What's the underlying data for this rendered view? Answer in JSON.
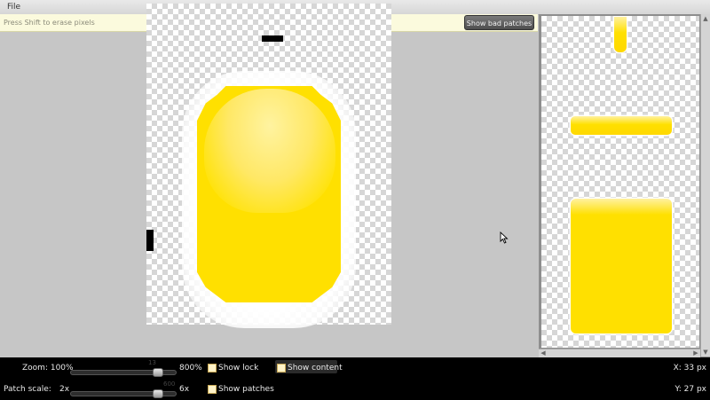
{
  "menu": {
    "file": "File"
  },
  "hint": {
    "text": "Press Shift to erase pixels"
  },
  "toolbar": {
    "bad_patches_label": "Show bad patches"
  },
  "controls": {
    "zoom_label": "Zoom: 100%",
    "zoom_max": "800%",
    "zoom_tick_note": "13",
    "patch_scale_label": "Patch scale:",
    "patch_min": "2x",
    "patch_max": "6x",
    "patch_tick_note": "600",
    "zoom_value_fraction": 0.85,
    "patch_value_fraction": 0.85,
    "show_lock": {
      "label": "Show lock",
      "checked": false
    },
    "show_content": {
      "label": "Show content",
      "checked": false
    },
    "show_patches": {
      "label": "Show patches",
      "checked": false
    }
  },
  "status": {
    "x_readout": "X: 33 px",
    "y_readout": "Y: 27 px"
  },
  "colors": {
    "pill_yellow": "#ffe000",
    "checker_light": "#ffffff",
    "checker_dark": "#d6d6d6",
    "patch_marker": "#000000"
  }
}
